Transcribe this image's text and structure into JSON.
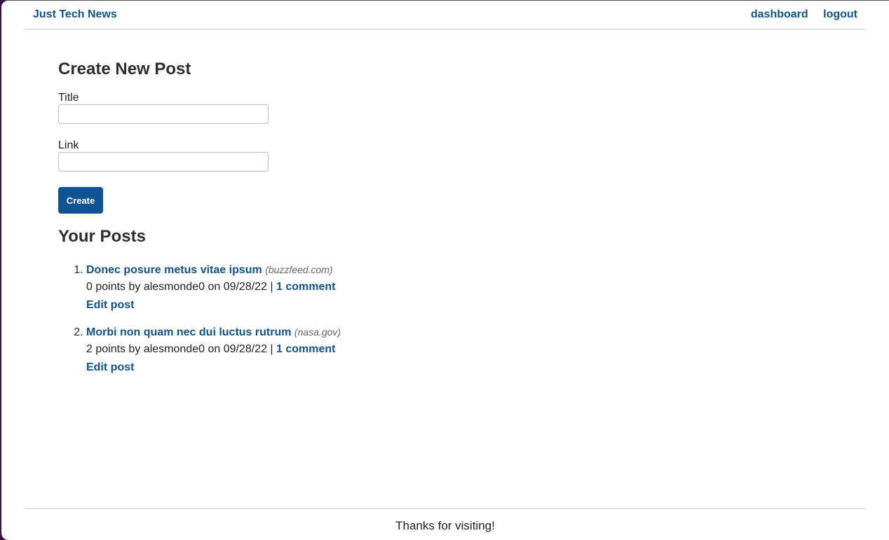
{
  "header": {
    "brand": "Just Tech News",
    "nav": {
      "dashboard": "dashboard",
      "logout": "logout"
    }
  },
  "create_post": {
    "heading": "Create New Post",
    "title_label": "Title",
    "title_value": "",
    "link_label": "Link",
    "link_value": "",
    "button_label": "Create"
  },
  "your_posts": {
    "heading": "Your Posts",
    "posts": [
      {
        "title": "Donec posure metus vitae ipsum",
        "domain": "(buzzfeed.com)",
        "meta": "0 points by alesmonde0 on 09/28/22 |",
        "comments": "1 comment",
        "edit": "Edit post"
      },
      {
        "title": "Morbi non quam nec dui luctus rutrum",
        "domain": "(nasa.gov)",
        "meta": "2 points by alesmonde0 on 09/28/22 |",
        "comments": "1 comment",
        "edit": "Edit post"
      }
    ]
  },
  "footer": {
    "text": "Thanks for visiting!"
  },
  "colors": {
    "accent": "#0f5395",
    "text": "#2b2b2b"
  }
}
